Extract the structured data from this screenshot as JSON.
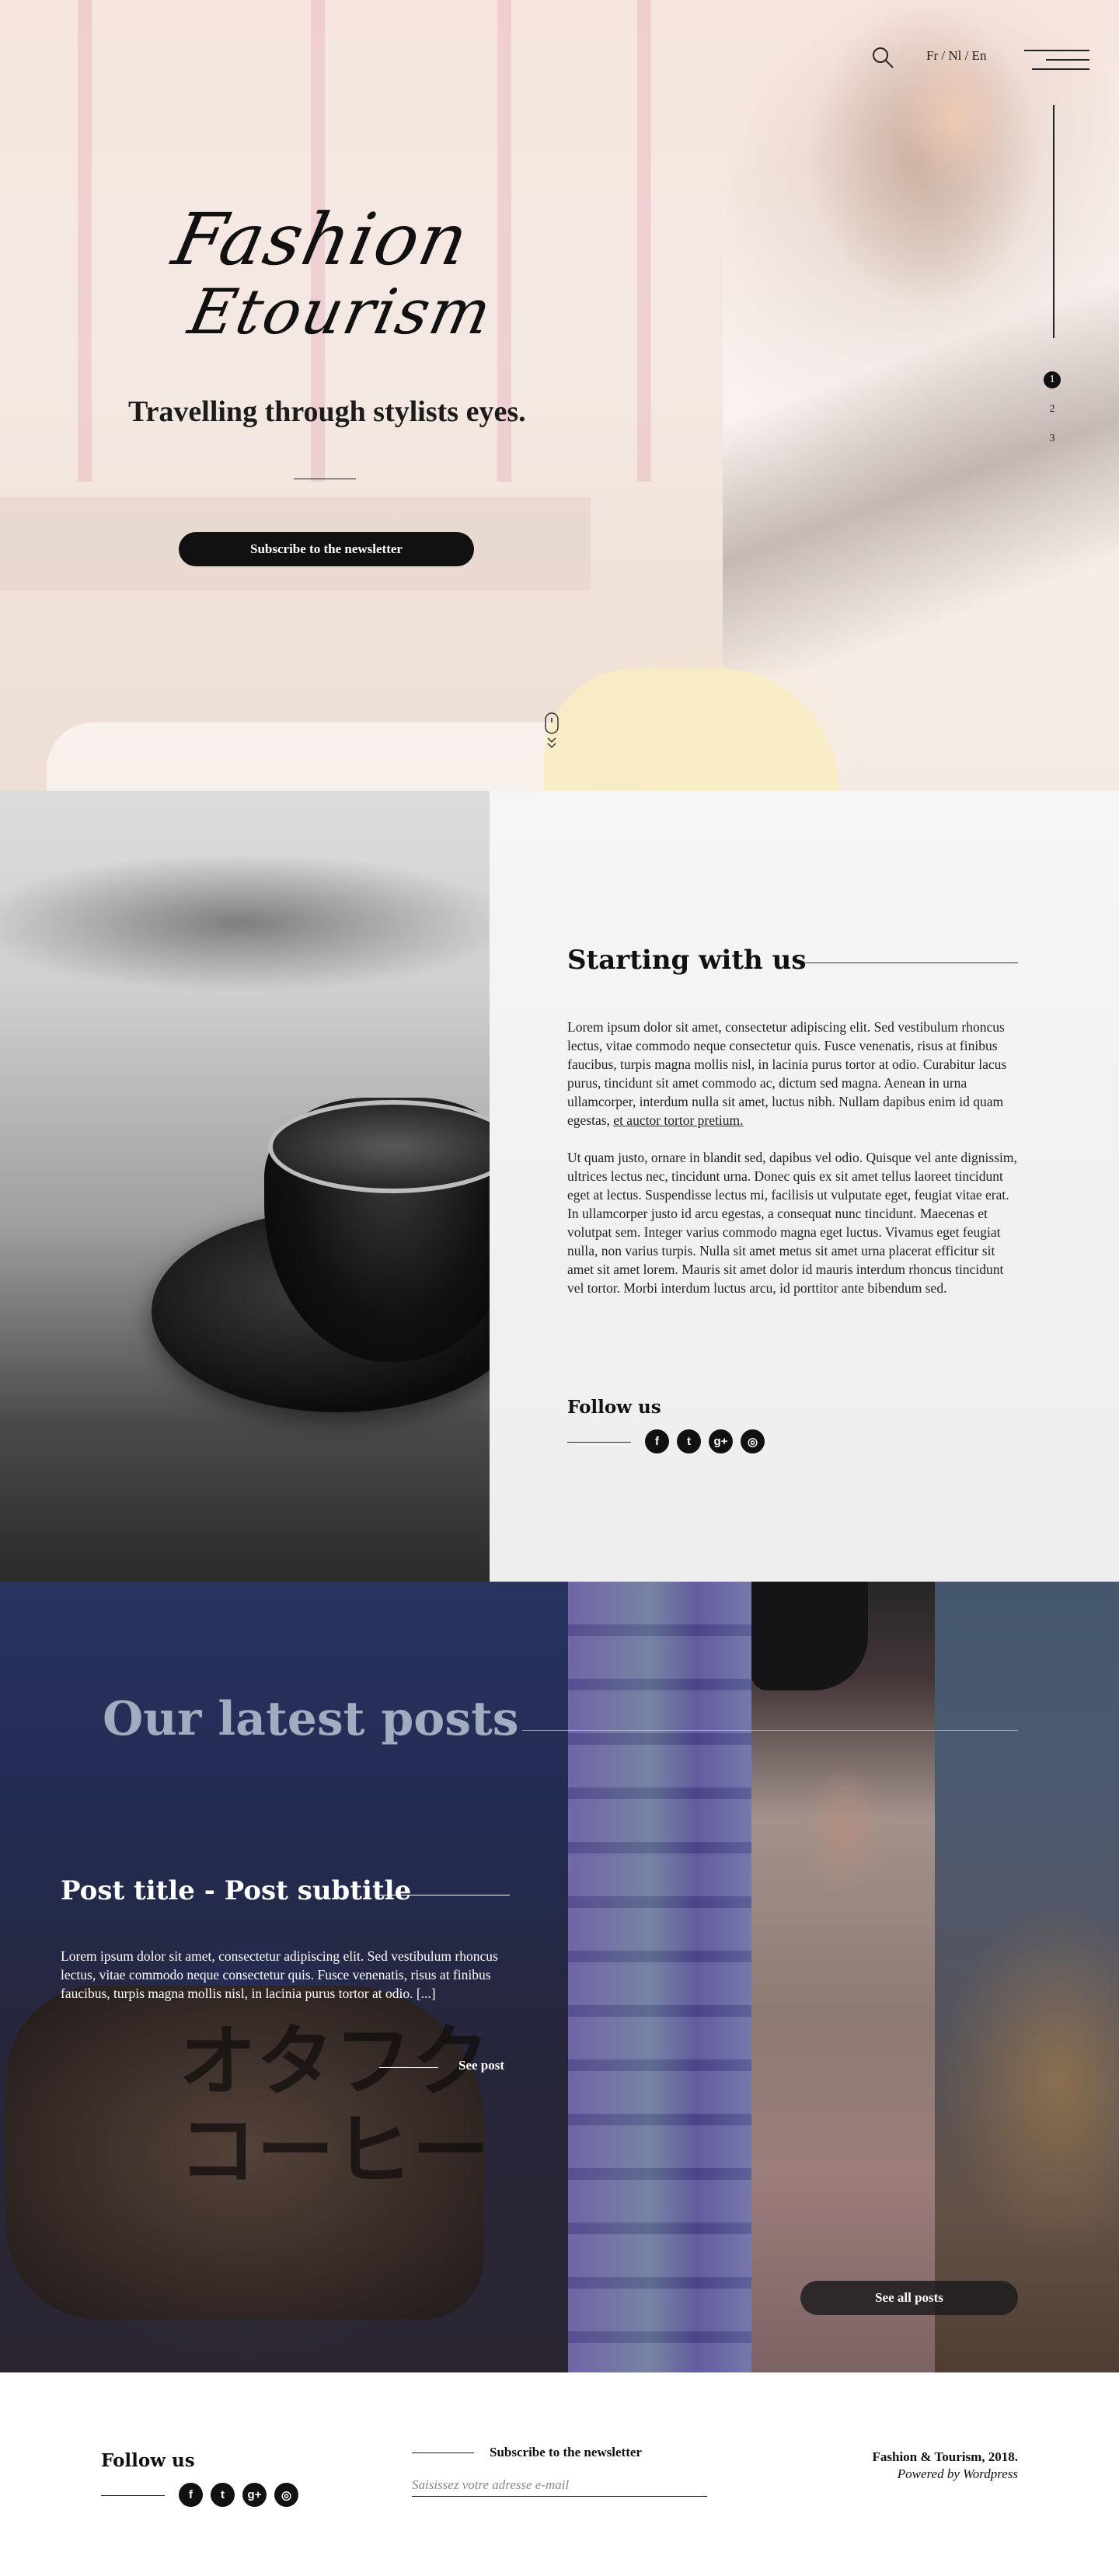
{
  "hero": {
    "brand_line1": "Fashion",
    "brand_line2": "Etourism",
    "tagline": "Travelling through stylists eyes.",
    "newsletter_button": "Subscribe to the newsletter",
    "language_switch": "Fr / Nl / En",
    "slides": [
      "1",
      "2",
      "3"
    ],
    "active_slide": "1"
  },
  "about": {
    "title": "Starting with us",
    "paragraph1": "Lorem ipsum dolor sit amet, consectetur adipiscing elit. Sed vestibulum rhoncus lectus, vitae commodo neque consectetur quis. Fusce venenatis, risus at finibus faucibus, turpis magna mollis nisl, in lacinia purus tortor at odio. Curabitur lacus purus, tincidunt sit amet commodo ac, dictum sed magna. Aenean in urna ullamcorper, interdum nulla sit amet, luctus nibh. Nullam dapibus enim id quam egestas,",
    "paragraph1_link": "et auctor tortor pretium.",
    "paragraph2": "Ut quam justo, ornare in blandit sed, dapibus vel odio. Quisque vel ante dignissim, ultrices lectus nec, tincidunt urna. Donec quis ex sit amet tellus laoreet tincidunt eget at lectus. Suspendisse lectus mi, facilisis ut vulputate eget, feugiat vitae erat. In ullamcorper justo id arcu egestas, a consequat nunc tincidunt. Maecenas et volutpat sem. Integer varius commodo magna eget luctus. Vivamus eget feugiat nulla, non varius turpis. Nulla sit amet metus sit amet urna placerat efficitur sit amet sit amet lorem. Mauris sit amet dolor id mauris interdum rhoncus tincidunt vel tortor. Morbi interdum luctus arcu, id porttitor ante bibendum sed.",
    "follow_title": "Follow us"
  },
  "social_icons": {
    "facebook": "f",
    "twitter": "t",
    "googleplus": "g+",
    "instagram": "◎"
  },
  "latest": {
    "title": "Our latest posts",
    "post_title": "Post title - Post subtitle",
    "post_excerpt": "Lorem ipsum dolor sit amet, consectetur adipiscing elit. Sed vestibulum rhoncus lectus, vitae commodo neque consectetur quis. Fusce venenatis, risus at finibus faucibus, turpis magna mollis nisl, in lacinia purus tortor at odio.",
    "post_more": "[...]",
    "see_post": "See post",
    "see_all": "See all posts",
    "sign_text": "オタフク\nコーヒー"
  },
  "footer": {
    "follow_title": "Follow us",
    "newsletter_title": "Subscribe to the newsletter",
    "email_placeholder": "Saisissez votre adresse e-mail",
    "copyright": "Fashion & Tourism, 2018.",
    "powered_by": "Powered by Wordpress"
  },
  "colors": {
    "dark": "#111111",
    "latest_title": "#a9b3c6",
    "white": "#ffffff"
  }
}
